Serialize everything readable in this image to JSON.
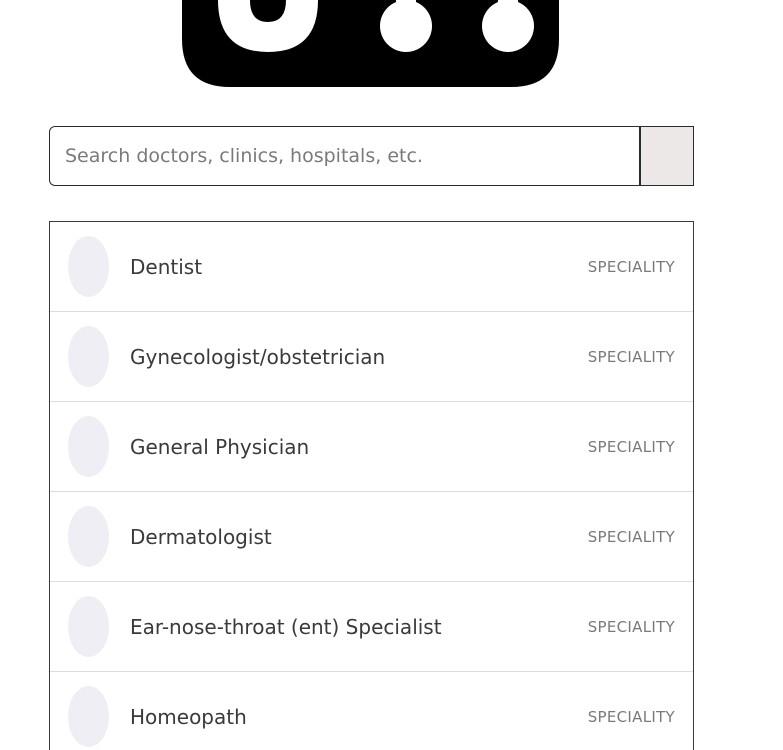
{
  "search": {
    "placeholder": "Search doctors, clinics, hospitals, etc."
  },
  "results": [
    {
      "name": "Dentist",
      "type": "SPECIALITY"
    },
    {
      "name": "Gynecologist/obstetrician",
      "type": "SPECIALITY"
    },
    {
      "name": "General Physician",
      "type": "SPECIALITY"
    },
    {
      "name": "Dermatologist",
      "type": "SPECIALITY"
    },
    {
      "name": "Ear-nose-throat (ent) Specialist",
      "type": "SPECIALITY"
    },
    {
      "name": "Homeopath",
      "type": "SPECIALITY"
    }
  ]
}
